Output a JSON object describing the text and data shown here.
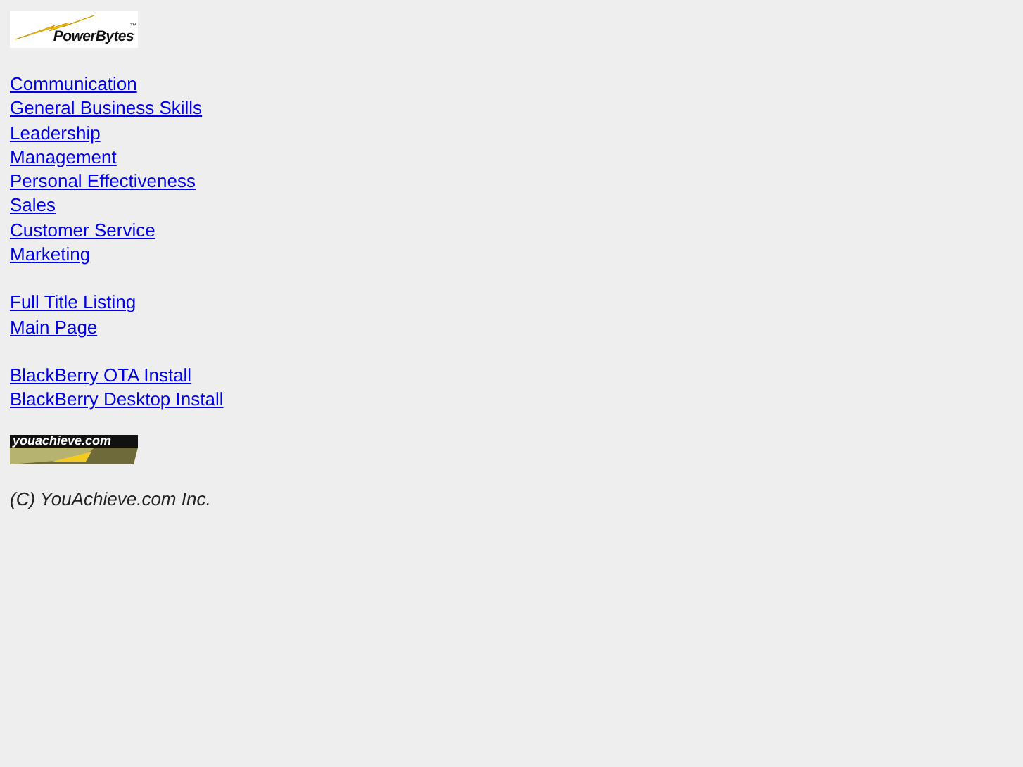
{
  "header_logo": {
    "text": "PowerBytes",
    "mark": "™"
  },
  "link_groups": [
    {
      "links": [
        "Communication",
        "General Business Skills",
        "Leadership",
        "Management",
        "Personal Effectiveness",
        "Sales",
        "Customer Service",
        "Marketing"
      ]
    },
    {
      "links": [
        "Full Title Listing",
        "Main Page"
      ]
    },
    {
      "links": [
        "BlackBerry OTA Install",
        "BlackBerry Desktop Install"
      ]
    }
  ],
  "footer_logo": {
    "text": "youachieve.com"
  },
  "copyright": "(C) YouAchieve.com Inc."
}
